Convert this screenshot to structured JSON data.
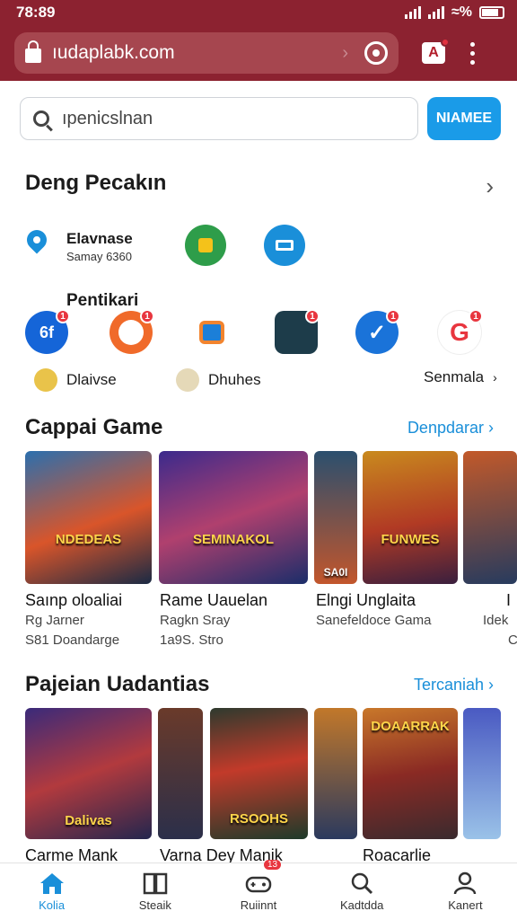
{
  "status_bar": {
    "time": "78:89"
  },
  "browser": {
    "url": "ıudaplabk.com"
  },
  "search": {
    "placeholder": "ıpenicslnan",
    "button_label": "NIAMEE"
  },
  "section1": {
    "title": "Deng Pecakın",
    "location_name": "Elavnase",
    "location_sub": "Samay 6360",
    "sub_label": "Pentikari",
    "apps": [
      {
        "name": "app-6f",
        "text": "6f",
        "badge": "1"
      },
      {
        "name": "app-face",
        "text": "",
        "badge": "1"
      },
      {
        "name": "app-doc",
        "text": "",
        "badge": ""
      },
      {
        "name": "app-game",
        "text": "",
        "badge": "1"
      },
      {
        "name": "app-check",
        "text": "",
        "badge": "1"
      },
      {
        "name": "app-g",
        "text": "G",
        "badge": "1"
      }
    ],
    "chips": [
      "Dlaivse",
      "Dhuhes"
    ],
    "more_link": "Senmala"
  },
  "section2": {
    "title": "Cappai Game",
    "more_link": "Denpdarar",
    "cards": [
      {
        "art_text": "NDEDEAS",
        "title": "Saınp oloaliai",
        "sub1": "Rg Jarner",
        "sub2": "S81 Doandarge"
      },
      {
        "art_text": "SEMINAKOL",
        "title": "Rame Uauelan",
        "sub1": "Ragkn Sray",
        "sub2": "1a9S. Stro"
      },
      {
        "art_text": "SA0I",
        "title": "",
        "sub1": "",
        "sub2": ""
      },
      {
        "art_text": "FUNWES",
        "title": "Elngi Unglaita",
        "sub1": "Sanefeldoce Gama",
        "sub2": ""
      },
      {
        "art_text": "",
        "title": "I",
        "sub1": "Idek",
        "sub2": "C"
      }
    ]
  },
  "section3": {
    "title": "Pajeian Uadantias",
    "more_link": "Tercaniah",
    "cards": [
      {
        "art_text": "Dalivas",
        "title": "Carme Mank"
      },
      {
        "art_text": "",
        "title": ""
      },
      {
        "art_text": "RSOOHS",
        "title": "Varna Dey Manik"
      },
      {
        "art_text": "",
        "title": ""
      },
      {
        "art_text": "DOAARRAK",
        "title": "Roacarlie"
      },
      {
        "art_text": "",
        "title": ""
      }
    ]
  },
  "nav": [
    {
      "label": "Kolia",
      "icon": "home-icon"
    },
    {
      "label": "Steaik",
      "icon": "book-icon"
    },
    {
      "label": "Ruiinnt",
      "icon": "controller-icon",
      "badge": "13"
    },
    {
      "label": "Kadtdda",
      "icon": "search-icon"
    },
    {
      "label": "Kanert",
      "icon": "profile-icon"
    }
  ]
}
